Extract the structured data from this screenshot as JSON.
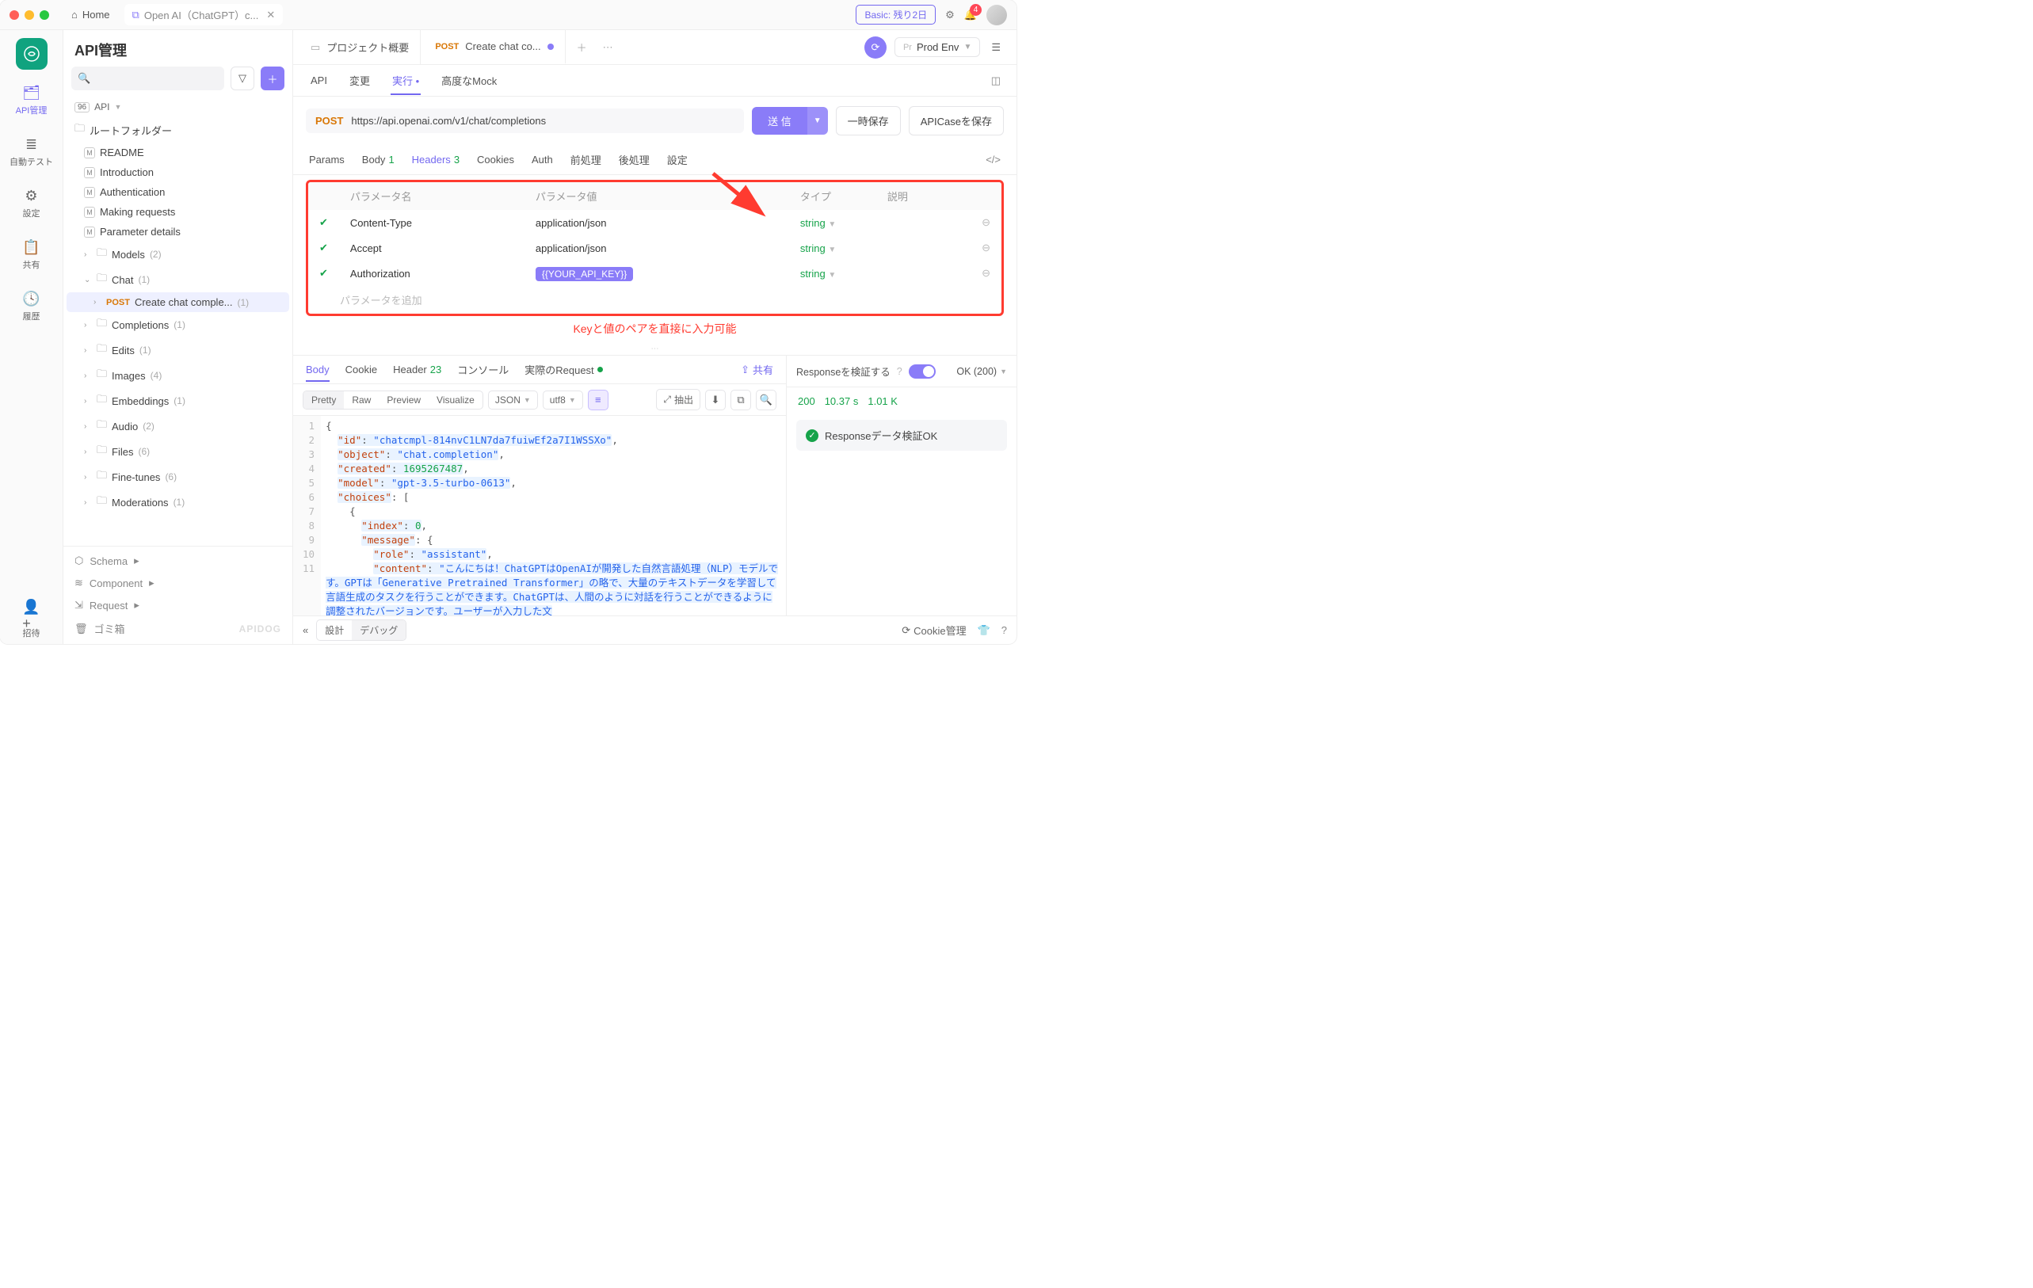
{
  "titlebar": {
    "home": "Home",
    "tab_title": "Open AI（ChatGPT）c...",
    "plan": "Basic: 残り2日",
    "notifications": "4"
  },
  "rail": {
    "items": [
      {
        "label": "API管理",
        "active": true
      },
      {
        "label": "自動テスト"
      },
      {
        "label": "設定"
      },
      {
        "label": "共有"
      },
      {
        "label": "履歴"
      }
    ],
    "invite": "招待"
  },
  "sidebar": {
    "title": "API管理",
    "api_label": "API",
    "root_folder": "ルートフォルダー",
    "docs": [
      "README",
      "Introduction",
      "Authentication",
      "Making requests",
      "Parameter details"
    ],
    "folders": [
      {
        "name": "Models",
        "count": "(2)",
        "open": false
      },
      {
        "name": "Chat",
        "count": "(1)",
        "open": true,
        "children": [
          {
            "method": "POST",
            "name": "Create chat comple...",
            "count": "(1)",
            "selected": true
          }
        ]
      },
      {
        "name": "Completions",
        "count": "(1)"
      },
      {
        "name": "Edits",
        "count": "(1)"
      },
      {
        "name": "Images",
        "count": "(4)"
      },
      {
        "name": "Embeddings",
        "count": "(1)"
      },
      {
        "name": "Audio",
        "count": "(2)"
      },
      {
        "name": "Files",
        "count": "(6)"
      },
      {
        "name": "Fine-tunes",
        "count": "(6)"
      },
      {
        "name": "Moderations",
        "count": "(1)"
      }
    ],
    "bottom": {
      "schema": "Schema",
      "component": "Component",
      "request": "Request",
      "trash": "ゴミ箱",
      "brand": "APIDOG"
    }
  },
  "main_tabs": {
    "overview": "プロジェクト概要",
    "active_method": "POST",
    "active_title": "Create chat co...",
    "env_prefix": "Pr",
    "env": "Prod Env"
  },
  "subtabs": [
    "API",
    "変更",
    "実行",
    "高度なMock"
  ],
  "url": {
    "method": "POST",
    "value": "https://api.openai.com/v1/chat/completions"
  },
  "buttons": {
    "send": "送 信",
    "save_temp": "一時保存",
    "save_case": "APICaseを保存"
  },
  "req_tabs": {
    "params": "Params",
    "body": "Body",
    "body_count": "1",
    "headers": "Headers",
    "headers_count": "3",
    "cookies": "Cookies",
    "auth": "Auth",
    "pre": "前処理",
    "post": "後処理",
    "settings": "設定"
  },
  "headers_table": {
    "col_name": "パラメータ名",
    "col_value": "パラメータ値",
    "col_type": "タイプ",
    "col_desc": "説明",
    "rows": [
      {
        "name": "Content-Type",
        "value": "application/json",
        "type": "string",
        "chip": false
      },
      {
        "name": "Accept",
        "value": "application/json",
        "type": "string",
        "chip": false
      },
      {
        "name": "Authorization",
        "value": "{{YOUR_API_KEY}}",
        "type": "string",
        "chip": true
      }
    ],
    "add": "パラメータを追加",
    "annotation": "Keyと値のペアを直接に入力可能"
  },
  "resp_tabs": {
    "body": "Body",
    "cookie": "Cookie",
    "header": "Header",
    "header_count": "23",
    "console": "コンソール",
    "actual": "実際のRequest",
    "share": "共有"
  },
  "view_bar": {
    "pretty": "Pretty",
    "raw": "Raw",
    "preview": "Preview",
    "visualize": "Visualize",
    "format": "JSON",
    "enc": "utf8",
    "extract": "抽出"
  },
  "response_json": {
    "id": "chatcmpl-814nvC1LN7da7fuiwEf2a7I1WSSXo",
    "object": "chat.completion",
    "created": 1695267487,
    "model": "gpt-3.5-turbo-0613",
    "role": "assistant",
    "content": "こんにちは！ChatGPTはOpenAIが開発した自然言語処理（NLP）モデルです。GPTは「Generative Pretrained Transformer」の略で、大量のテキストデータを学習して言語生成のタスクを行うことができます。ChatGPTは、人間のように対話を行うことができるように調整されたバージョンです。ユーザーが入力した文"
  },
  "verify": {
    "label": "Responseを検証する",
    "status": "OK (200)",
    "code": "200",
    "time": "10.37 s",
    "size": "1.01 K",
    "ok": "Responseデータ検証OK"
  },
  "footer": {
    "design": "設計",
    "debug": "デバッグ",
    "cookie": "Cookie管理"
  }
}
